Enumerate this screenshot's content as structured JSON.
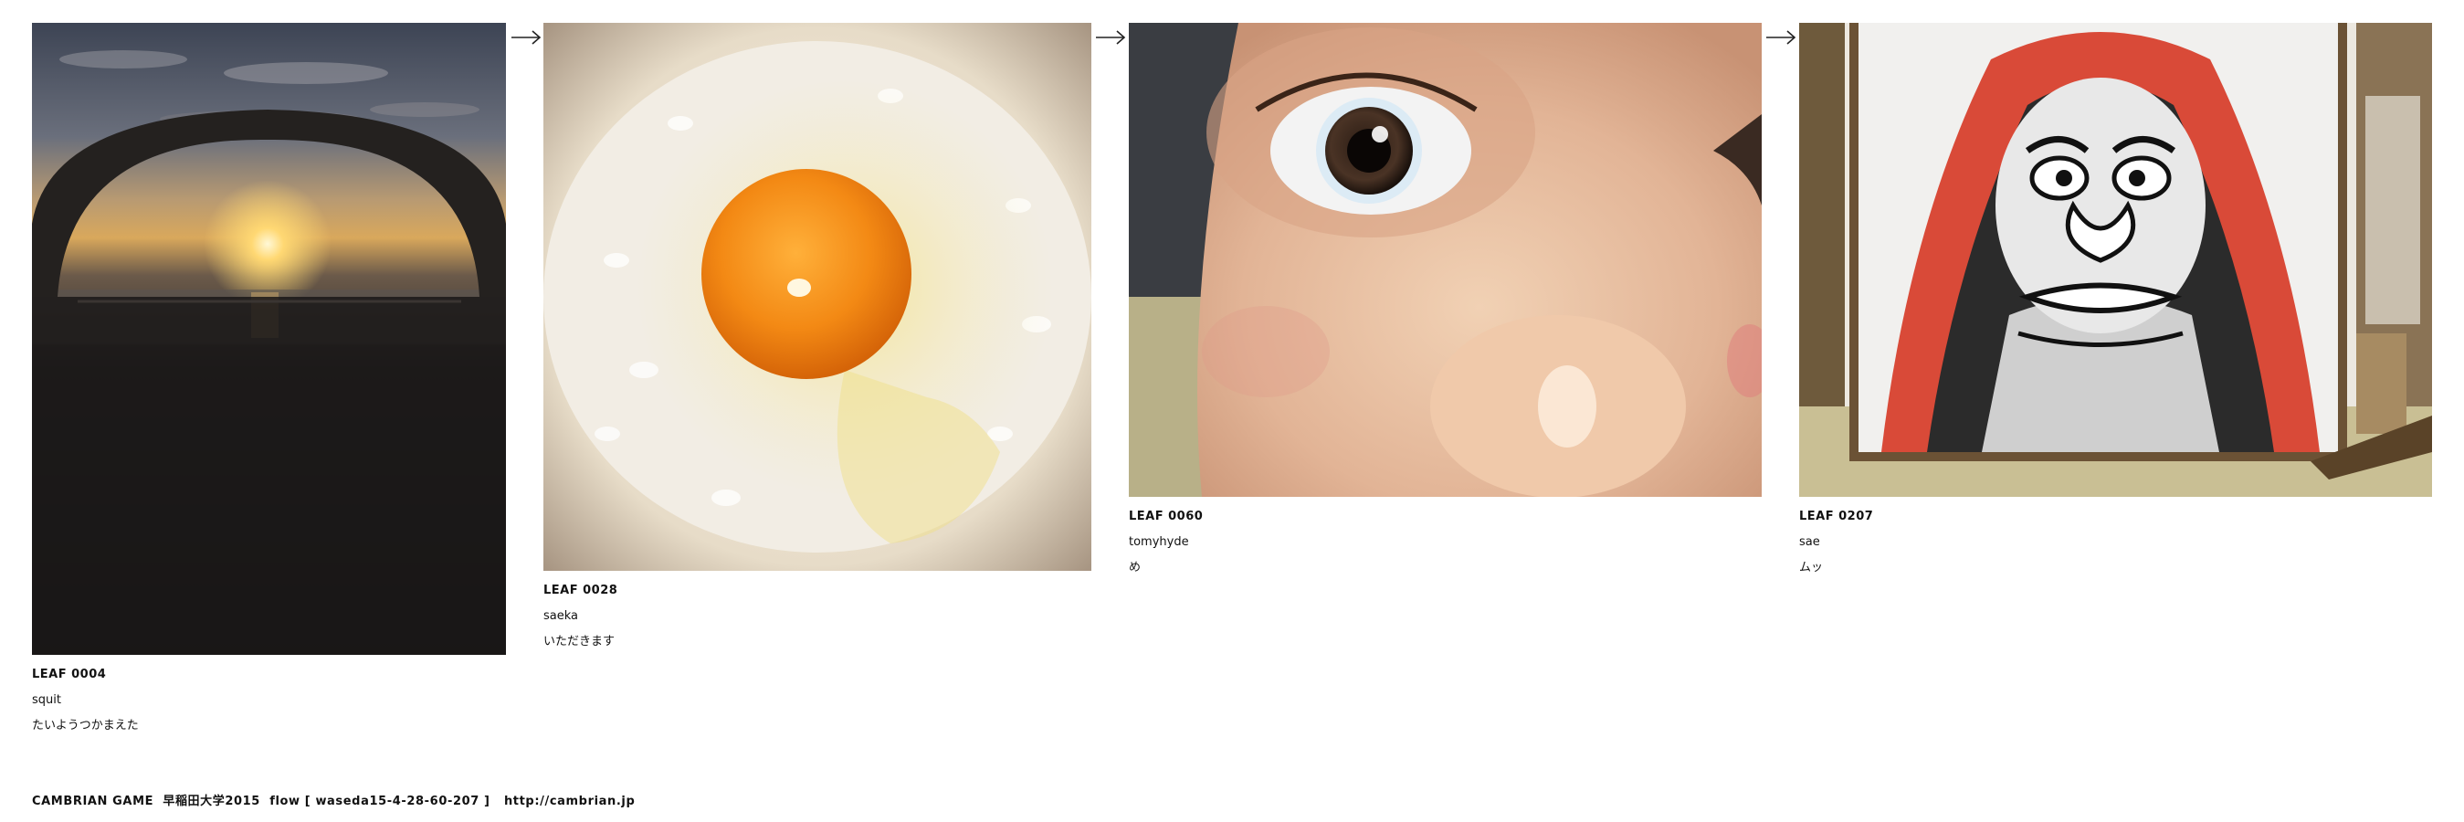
{
  "leaves": [
    {
      "id": "LEAF 0004",
      "author": "squit",
      "comment": "たいようつかまえた",
      "photo": "sunset-arch-photo"
    },
    {
      "id": "LEAF 0028",
      "author": "saeka",
      "comment": "いただきます",
      "photo": "egg-on-rice-photo"
    },
    {
      "id": "LEAF 0060",
      "author": "tomyhyde",
      "comment": "め",
      "photo": "eye-closeup-photo"
    },
    {
      "id": "LEAF 0207",
      "author": "sae",
      "comment": "ムッ",
      "photo": "daruma-banner-photo"
    }
  ],
  "footer": {
    "text": "CAMBRIAN GAME  早稲田大学2015  flow [ waseda15-4-28-60-207 ]",
    "link": "http://cambrian.jp"
  },
  "icons": {
    "arrow": "right-arrow-icon"
  }
}
